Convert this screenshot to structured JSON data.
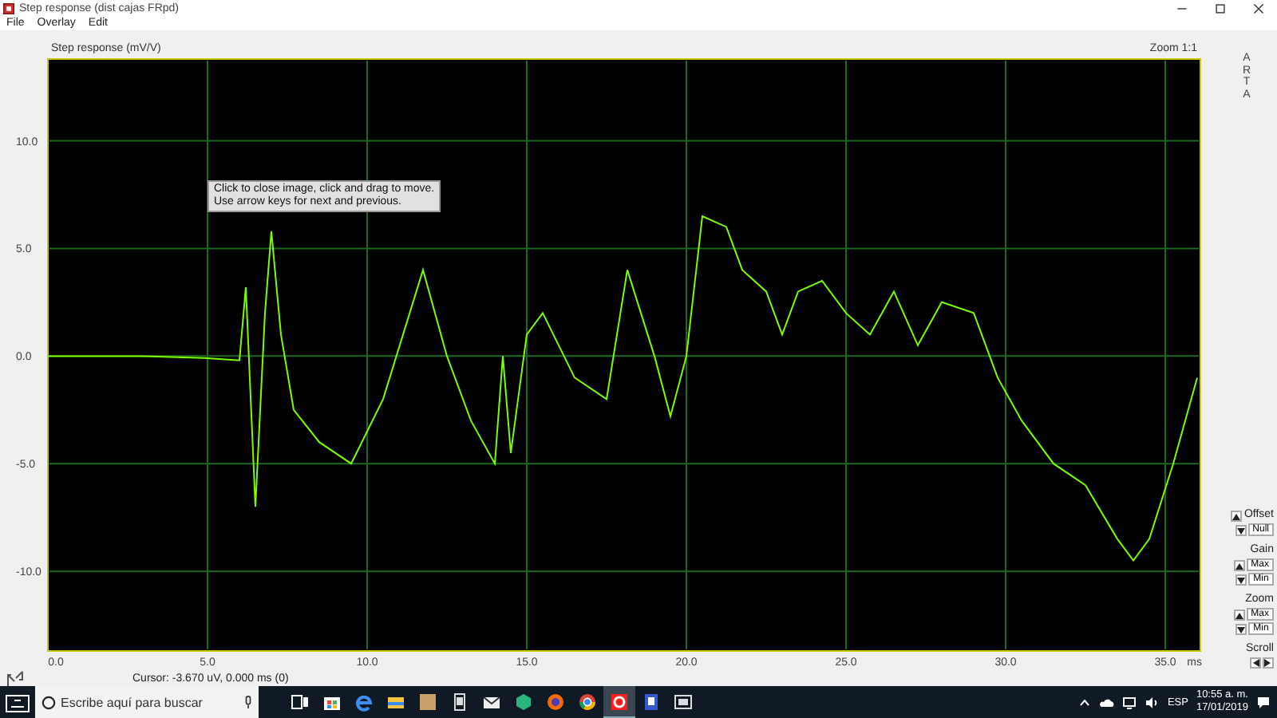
{
  "window": {
    "title": "Step response (dist cajas FRpd)"
  },
  "menu": [
    "File",
    "Overlay",
    "Edit"
  ],
  "chart": {
    "zoom_label": "Zoom 1:1",
    "tooltip": "Click to close image, click and drag to move.\nUse arrow keys for next and previous.",
    "chart_data": {
      "type": "line",
      "grid": true,
      "title": "Step response (mV/V)",
      "xlabel": "ms",
      "x": [
        0,
        3,
        5,
        6,
        6.2,
        6.5,
        6.8,
        7,
        7.3,
        7.7,
        8.5,
        9.5,
        10.5,
        11.75,
        12.5,
        13.25,
        14,
        14.25,
        14.5,
        15,
        15.5,
        16.5,
        17.5,
        18.15,
        19,
        19.5,
        20,
        20.5,
        21.25,
        21.75,
        22.5,
        23,
        23.5,
        24.25,
        25,
        25.75,
        26.5,
        27.25,
        28,
        29,
        29.75,
        30.5,
        31.5,
        32.5,
        33.5,
        34,
        34.5,
        35.25,
        36
      ],
      "values": [
        0,
        0,
        -0.1,
        -0.2,
        3.2,
        -7,
        2,
        5.8,
        1,
        -2.5,
        -4,
        -5,
        -2,
        4,
        0,
        -3,
        -5,
        0,
        -4.5,
        1,
        2,
        -1,
        -2,
        4,
        0,
        -2.8,
        0,
        6.5,
        6,
        4,
        3,
        1,
        3,
        3.5,
        2,
        1,
        3,
        0.5,
        2.5,
        2,
        -1,
        -3,
        -5,
        -6,
        -8.5,
        -9.5,
        -8.5,
        -5,
        -1
      ],
      "xlim": [
        0,
        36.1
      ],
      "ylim": [
        -13.7,
        13.8
      ],
      "xticks": [
        {
          "value": 0,
          "label": "0.0"
        },
        {
          "value": 5,
          "label": "5.0"
        },
        {
          "value": 10,
          "label": "10.0"
        },
        {
          "value": 15,
          "label": "15.0"
        },
        {
          "value": 20,
          "label": "20.0"
        },
        {
          "value": 25,
          "label": "25.0"
        },
        {
          "value": 30,
          "label": "30.0"
        },
        {
          "value": 35,
          "label": "35.0"
        }
      ],
      "yticks": [
        {
          "value": 10,
          "label": "10.0"
        },
        {
          "value": 5,
          "label": "5.0"
        },
        {
          "value": 0,
          "label": "0.0"
        },
        {
          "value": -5,
          "label": "-5.0"
        },
        {
          "value": -10,
          "label": "-10.0"
        }
      ]
    }
  },
  "side_panel": {
    "logo": "ARTA",
    "groups": [
      {
        "kind": "offset",
        "title": "Offset",
        "button": "Null"
      },
      {
        "kind": "range",
        "title": "Gain",
        "buttons": [
          "Max",
          "Min"
        ]
      },
      {
        "kind": "range",
        "title": "Zoom",
        "buttons": [
          "Max",
          "Min"
        ]
      },
      {
        "kind": "scroll",
        "title": "Scroll"
      }
    ]
  },
  "status": {
    "cursor": "Cursor:  -3.670 uV,    0.000 ms  (0)"
  },
  "taskbar": {
    "search_placeholder": "Escribe aquí para buscar",
    "language": "ESP",
    "time": "10:55 a. m.",
    "date": "17/01/2019"
  }
}
